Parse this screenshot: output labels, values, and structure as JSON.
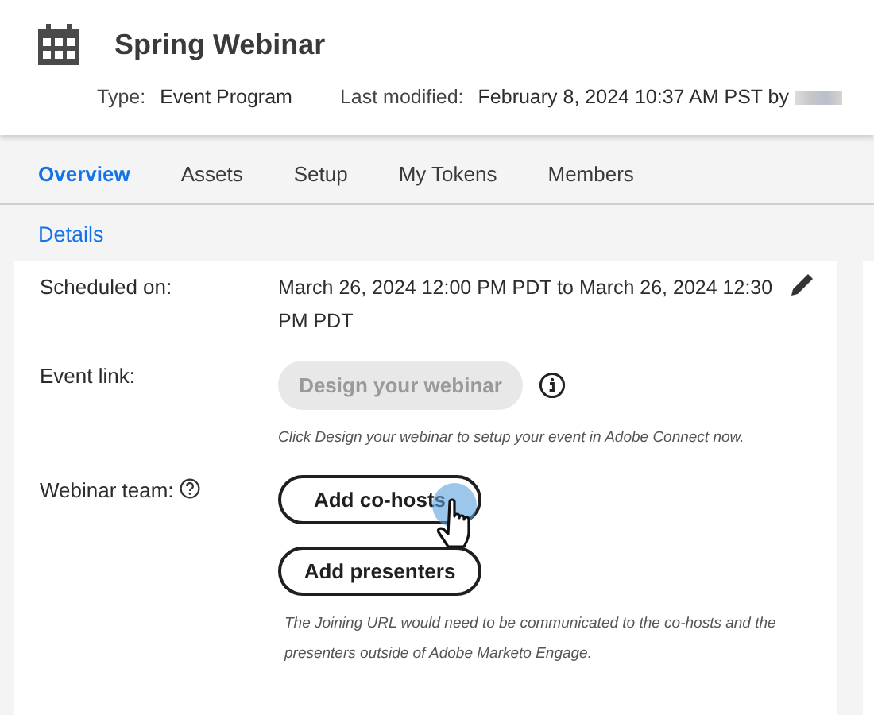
{
  "header": {
    "title": "Spring Webinar",
    "type_label": "Type:",
    "type_value": "Event Program",
    "modified_label": "Last modified:",
    "modified_value": "February 8, 2024 10:37 AM PST by"
  },
  "tabs": [
    {
      "label": "Overview",
      "selected": true
    },
    {
      "label": "Assets",
      "selected": false
    },
    {
      "label": "Setup",
      "selected": false
    },
    {
      "label": "My Tokens",
      "selected": false
    },
    {
      "label": "Members",
      "selected": false
    }
  ],
  "section_link": "Details",
  "fields": [
    {
      "kind": "schedule",
      "label": "Scheduled on:",
      "value": "March 26, 2024 12:00 PM PDT to March 26, 2024 12:30 PM PDT"
    },
    {
      "kind": "buttons",
      "label": "Event link:",
      "buttons": [
        {
          "label": "Design your webinar",
          "disabled": true
        }
      ],
      "info": true,
      "note": "Click Design your webinar to setup your event in Adobe Connect now."
    },
    {
      "kind": "buttons",
      "label": "Webinar team:",
      "help": true,
      "buttons": [
        {
          "label": "Add co-hosts",
          "disabled": false
        },
        {
          "label": "Add presenters",
          "disabled": false
        }
      ],
      "note": "The Joining URL would need to be communicated to the co-hosts and the presenters outside of Adobe Marketo Engage."
    }
  ]
}
